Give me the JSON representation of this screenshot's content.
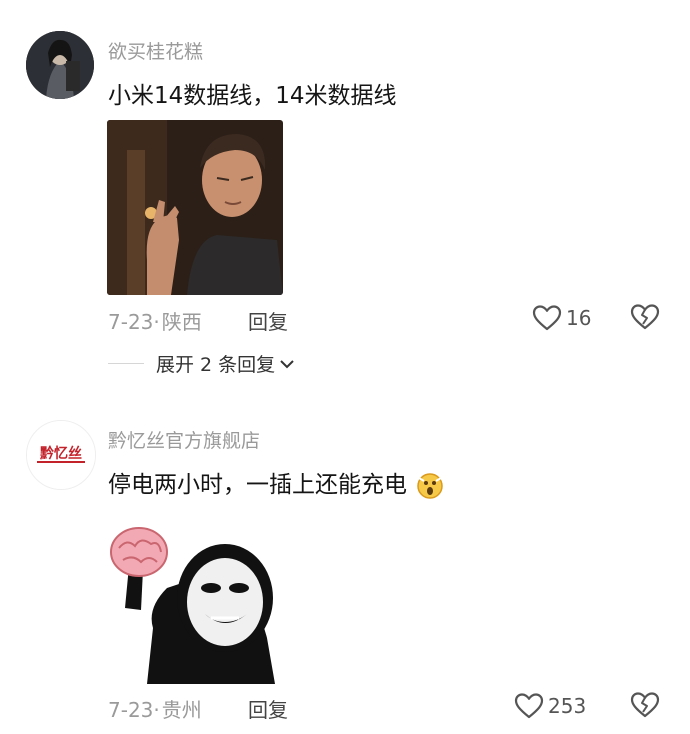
{
  "comments": [
    {
      "username": "欲买桂花糕",
      "text": "小米14数据线，14米数据线",
      "date": "7-23",
      "location": "陕西",
      "reply_label": "回复",
      "likes": "16",
      "expand_label": "展开 2 条回复"
    },
    {
      "username": "黔忆丝官方旗舰店",
      "text": "停电两小时，一插上还能充电",
      "date": "7-23",
      "location": "贵州",
      "reply_label": "回复",
      "likes": "253",
      "avatar_text": "黔忆丝"
    }
  ],
  "icons": {
    "like": "heart-outline-icon",
    "dislike": "broken-heart-icon",
    "expand": "chevron-down-icon",
    "emoji": "surprised-emoji-icon"
  },
  "colors": {
    "meta_gray": "#9a9a9a",
    "brand_red": "#c4222b"
  }
}
